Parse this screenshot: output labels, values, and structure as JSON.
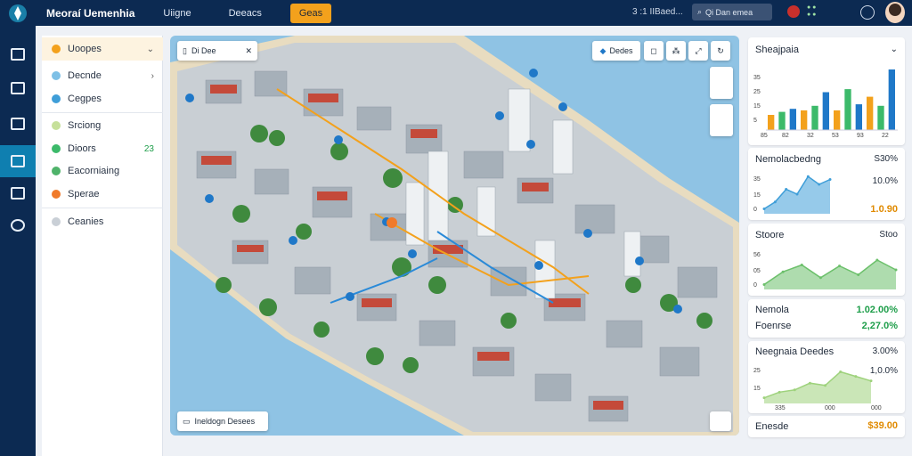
{
  "topbar": {
    "app_title": "Meoraí Uemenhia",
    "tabs": [
      {
        "label": "Uiigne"
      },
      {
        "label": "Deeacs"
      },
      {
        "label": "Geas"
      }
    ],
    "status": "3 :1 IIBaed...",
    "search_placeholder": "Qi Dan emea"
  },
  "rail": {
    "items": [
      {
        "icon": "home-icon"
      },
      {
        "icon": "layers-icon"
      },
      {
        "icon": "building-icon"
      },
      {
        "icon": "map-icon"
      },
      {
        "icon": "document-icon"
      },
      {
        "icon": "settings-icon"
      }
    ]
  },
  "sidebar": {
    "items": [
      {
        "label": "Uoopes",
        "trail": "",
        "color": "#f3a11c"
      },
      {
        "label": "Decnde",
        "trail": "",
        "color": "#7ec0e6"
      },
      {
        "label": "Cegpes",
        "trail": "",
        "color": "#3f9ed8"
      },
      {
        "label": "Srciong",
        "trail": "",
        "color": "#c6e09a"
      },
      {
        "label": "Dioors",
        "trail": "23",
        "color": "#3cba6a"
      },
      {
        "label": "Eacorniaing",
        "trail": "",
        "color": "#4fb36a"
      },
      {
        "label": "Sperae",
        "trail": "",
        "color": "#f07a2a"
      },
      {
        "label": "Ceanies",
        "trail": "",
        "color": "#c9cfd6"
      }
    ]
  },
  "map": {
    "search_text": "Di Dee",
    "toolbar_label": "Dedes",
    "legend_text": "Ineldogn Desees"
  },
  "panels": {
    "chart1": {
      "title": "Sheajpaia",
      "y_ticks": [
        "35",
        "25",
        "15",
        "5"
      ],
      "x_ticks": [
        "85",
        "82",
        "32",
        "53",
        "93",
        "22"
      ]
    },
    "chart2": {
      "title": "Nemolacbedng",
      "value": "S30%",
      "value2": "10.0%",
      "amount": "1.0.90",
      "y_ticks": [
        "35",
        "15",
        "0"
      ]
    },
    "chart3": {
      "title": "Stoore",
      "value": "Stoo",
      "y_ticks": [
        "56",
        "05",
        "0"
      ]
    },
    "stats": {
      "row1_label": "Nemola",
      "row1_value": "1.02.00%",
      "row2_label": "Foenrse",
      "row2_value": "2,27.0%"
    },
    "chart4": {
      "title": "Neegnaia Deedes",
      "value": "3.00%",
      "value2": "1,0.0%",
      "y_ticks": [
        "25",
        "15"
      ],
      "x_ticks": [
        "335",
        "000",
        "000"
      ]
    },
    "footer": {
      "label": "Enesde",
      "amount": "$39.00"
    }
  },
  "chart_data": [
    {
      "type": "bar",
      "title": "Sheajpaia",
      "categories": [
        "85",
        "",
        "82",
        "",
        "32",
        "",
        "53",
        "",
        "93",
        "",
        "22",
        ""
      ],
      "series": [
        {
          "values": [
            10,
            12,
            14,
            13,
            16,
            25,
            13,
            27,
            17,
            22,
            16,
            40
          ]
        }
      ],
      "colors": [
        "#f3a11c",
        "#3cba6a",
        "#1f78c8"
      ],
      "ylim": [
        0,
        40
      ]
    },
    {
      "type": "area",
      "title": "Nemolacbedng",
      "series": [
        {
          "values": [
            5,
            12,
            25,
            20,
            38,
            30,
            35
          ]
        }
      ],
      "color": "#3f9ed8",
      "ylim": [
        0,
        40
      ]
    },
    {
      "type": "area",
      "title": "Stoore",
      "series": [
        {
          "values": [
            5,
            18,
            25,
            12,
            24,
            15,
            30,
            20
          ]
        }
      ],
      "color": "#6cc06b",
      "ylim": [
        0,
        40
      ]
    },
    {
      "type": "area",
      "title": "Neegnaia Deedes",
      "series": [
        {
          "values": [
            5,
            10,
            12,
            18,
            16,
            28,
            24,
            20
          ]
        }
      ],
      "color": "#9ed27c",
      "ylim": [
        0,
        30
      ]
    }
  ]
}
